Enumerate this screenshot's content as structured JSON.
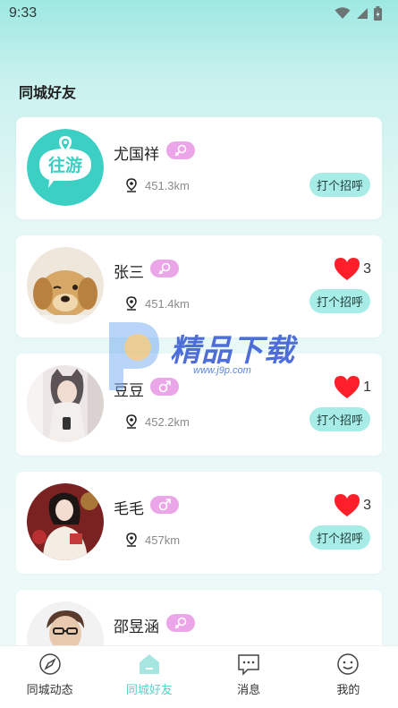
{
  "status_bar": {
    "time": "9:33"
  },
  "section": {
    "title": "同城好友"
  },
  "logo": {
    "text": "往游"
  },
  "users": [
    {
      "name": "尤国祥",
      "gender": "female",
      "distance": "451.3km",
      "greet_label": "打个招呼"
    },
    {
      "name": "张三",
      "gender": "female",
      "distance": "451.4km",
      "greet_label": "打个招呼",
      "likes": "3"
    },
    {
      "name": "豆豆",
      "gender": "male",
      "distance": "452.2km",
      "greet_label": "打个招呼",
      "likes": "1"
    },
    {
      "name": "毛毛",
      "gender": "male",
      "distance": "457km",
      "greet_label": "打个招呼",
      "likes": "3"
    },
    {
      "name": "邵昱涵",
      "gender": "female"
    }
  ],
  "watermark": {
    "text": "精品下载",
    "url": "www.j9p.com"
  },
  "tabbar": {
    "items": [
      {
        "label": "同城动态",
        "icon": "compass-icon"
      },
      {
        "label": "同城好友",
        "icon": "home-icon",
        "active": true
      },
      {
        "label": "消息",
        "icon": "message-icon"
      },
      {
        "label": "我的",
        "icon": "profile-icon"
      }
    ]
  },
  "colors": {
    "accent": "#57d2c7",
    "button_bg": "#a7ece6",
    "badge_pink": "#eaa6e8",
    "heart_red": "#ff1f2b"
  }
}
